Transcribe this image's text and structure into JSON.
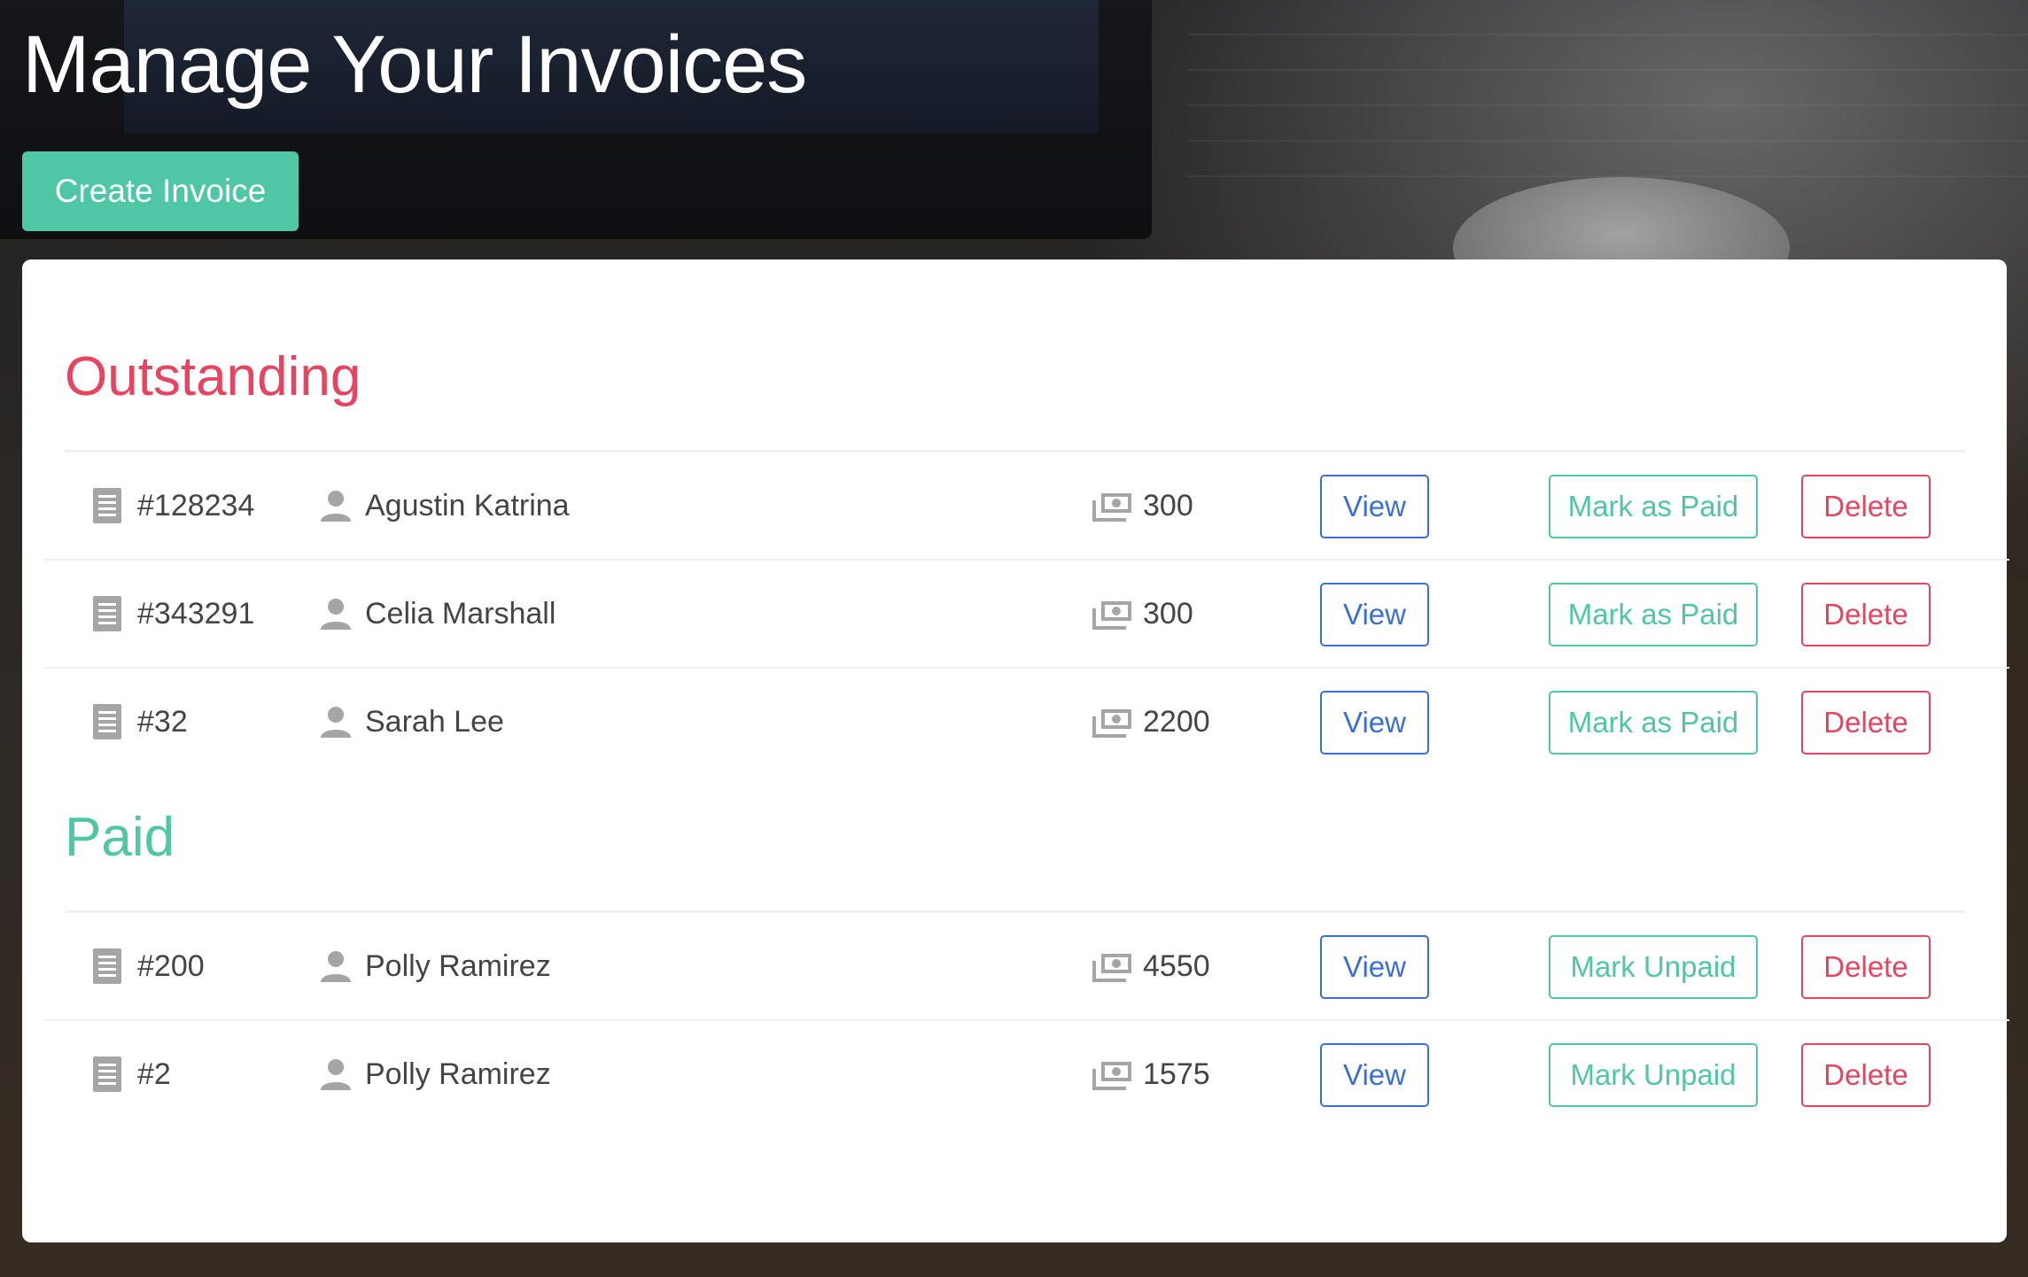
{
  "header": {
    "title": "Manage Your Invoices",
    "create_button_label": "Create Invoice"
  },
  "colors": {
    "outstanding": "#e8435f",
    "paid": "#4fc6a6",
    "view": "#3a6fd8",
    "create_button_bg": "#4fc6a6"
  },
  "icons": {
    "invoice": "document-icon",
    "client": "user-icon",
    "amount": "money-icon"
  },
  "outstanding": {
    "title": "Outstanding",
    "invoices": [
      {
        "number": "#128234",
        "client": "Agustin Katrina",
        "amount": "300",
        "view_label": "View",
        "toggle_label": "Mark as Paid",
        "delete_label": "Delete"
      },
      {
        "number": "#343291",
        "client": "Celia Marshall",
        "amount": "300",
        "view_label": "View",
        "toggle_label": "Mark as Paid",
        "delete_label": "Delete"
      },
      {
        "number": "#32",
        "client": "Sarah Lee",
        "amount": "2200",
        "view_label": "View",
        "toggle_label": "Mark as Paid",
        "delete_label": "Delete"
      }
    ]
  },
  "paid": {
    "title": "Paid",
    "invoices": [
      {
        "number": "#200",
        "client": "Polly Ramirez",
        "amount": "4550",
        "view_label": "View",
        "toggle_label": "Mark Unpaid",
        "delete_label": "Delete"
      },
      {
        "number": "#2",
        "client": "Polly Ramirez",
        "amount": "1575",
        "view_label": "View",
        "toggle_label": "Mark Unpaid",
        "delete_label": "Delete"
      }
    ]
  }
}
